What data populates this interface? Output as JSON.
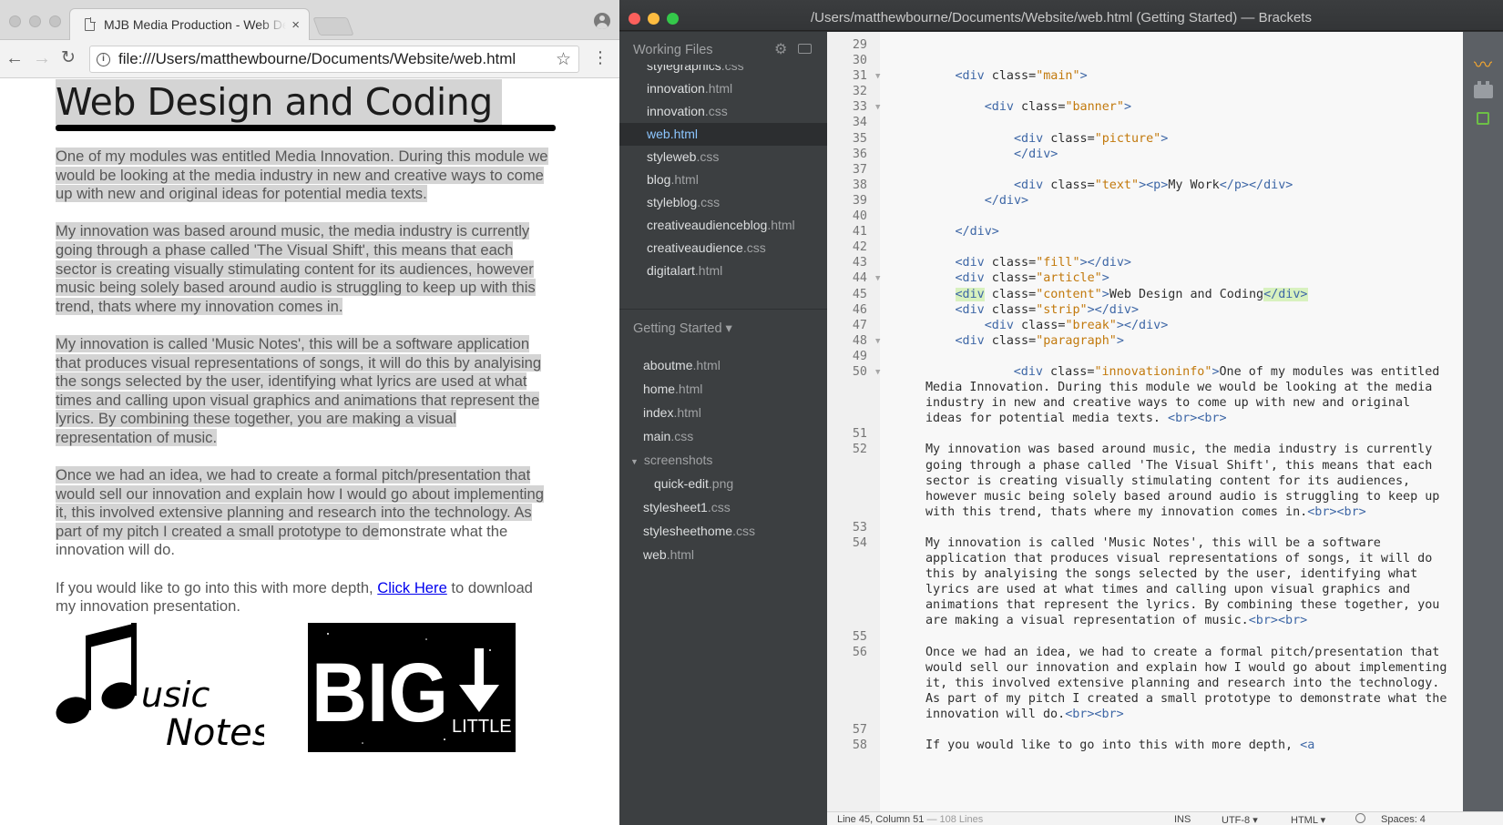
{
  "browser": {
    "tab_title": "MJB Media Production - Web Design",
    "tab_close": "×",
    "url": "file:///Users/matthewbourne/Documents/Website/web.html",
    "page": {
      "heading": "Web Design and Coding",
      "paragraphs": [
        "One of my modules was entitled Media Innovation. During this module we would be looking at the media industry in new and creative ways to come up with new and original ideas for potential media texts.",
        "My innovation was based around music, the media industry is currently going through a phase called 'The Visual Shift', this means that each sector is creating visually stimulating content for its audiences, however music being solely based around audio is struggling to keep up with this trend, thats where my innovation comes in.",
        "My innovation is called 'Music Notes', this will be a software application that produces visual representations of songs, it will do this by analyising the songs selected by the user, identifying what lyrics are used at what times and calling upon visual graphics and animations that represent the lyrics. By combining these together, you are making a visual representation of music."
      ],
      "para4_highlighted": "Once we had an idea, we had to create a formal pitch/presentation that would sell our innovation and explain how I would go about implementing it, this involved extensive planning and research into the technology. As part of my pitch I created a small prototype to de",
      "para4_rest": "monstrate what the innovation will do.",
      "link_para_before": "If you would like to go into this with more depth, ",
      "link_text": "Click Here",
      "link_para_after": " to download my innovation presentation.",
      "logo_music_text1": "usic",
      "logo_music_text2": "Notes",
      "logo_big_text": "BIG",
      "logo_little_text": "LITTLE"
    }
  },
  "editor": {
    "window_title": "/Users/matthewbourne/Documents/Website/web.html (Getting Started) — Brackets",
    "working_files_header": "Working Files",
    "working_files": [
      {
        "name": "stylegraphics",
        "ext": ".css"
      },
      {
        "name": "innovation",
        "ext": ".html"
      },
      {
        "name": "innovation",
        "ext": ".css"
      },
      {
        "name": "web",
        "ext": ".html"
      },
      {
        "name": "styleweb",
        "ext": ".css"
      },
      {
        "name": "blog",
        "ext": ".html"
      },
      {
        "name": "styleblog",
        "ext": ".css"
      },
      {
        "name": "creativeaudienceblog",
        "ext": ".html"
      },
      {
        "name": "creativeaudience",
        "ext": ".css"
      },
      {
        "name": "digitalart",
        "ext": ".html"
      }
    ],
    "project_header": "Getting Started ▾",
    "project_files": [
      {
        "name": "aboutme",
        "ext": ".html"
      },
      {
        "name": "home",
        "ext": ".html"
      },
      {
        "name": "index",
        "ext": ".html"
      },
      {
        "name": "main",
        "ext": ".css"
      },
      {
        "name": "screenshots",
        "ext": ""
      },
      {
        "name": "quick-edit",
        "ext": ".png"
      },
      {
        "name": "stylesheet1",
        "ext": ".css"
      },
      {
        "name": "stylesheethome",
        "ext": ".css"
      },
      {
        "name": "web",
        "ext": ".html"
      }
    ],
    "status": {
      "position": "Line 45, Column 51",
      "lines": " — 108 Lines",
      "mode": "INS",
      "encoding": "UTF-8 ▾",
      "language": "HTML ▾",
      "spaces": "Spaces: 4"
    },
    "line_numbers": [
      "29",
      "30",
      "31",
      "32",
      "33",
      "34",
      "35",
      "36",
      "37",
      "38",
      "39",
      "40",
      "41",
      "42",
      "43",
      "44",
      "45",
      "46",
      "47",
      "48",
      "49",
      "50",
      "51",
      "52",
      "53",
      "54",
      "55",
      "56",
      "57",
      "58"
    ],
    "code": {
      "l50": "One of my modules was entitled Media Innovation. During this module we would be looking at the media industry in new and creative ways to come up with new and original ideas for potential media texts.",
      "l52": "My innovation was based around music, the media industry is currently going through a phase called 'The Visual Shift', this means that each sector is creating visually stimulating content for its audiences, however music being solely based around audio is struggling to keep up with this trend, thats where my innovation comes in.",
      "l54": "My innovation is called 'Music Notes', this will be a software application that produces visual representations of songs, it will do this by analyising the songs selected by the user, identifying what lyrics are used at what times and calling upon visual graphics and animations that represent the lyrics. By combining these together, you are making a visual representation of music.",
      "l56": "Once we had an idea, we had to create a formal pitch/presentation that would sell our innovation and explain how I would go about implementing it, this involved extensive planning and research into the technology. As part of my pitch I created a small prototype to demonstrate what the innovation will do.",
      "l58": "If you would like to go into this with more depth, ",
      "l38_text": "My Work",
      "l45_text": "Web Design and Coding"
    }
  },
  "colors": {
    "tag": "#3e67a6",
    "string": "#c2790c",
    "active_file": "#8cc6ff",
    "sidebar_bg": "#3c3f41"
  }
}
